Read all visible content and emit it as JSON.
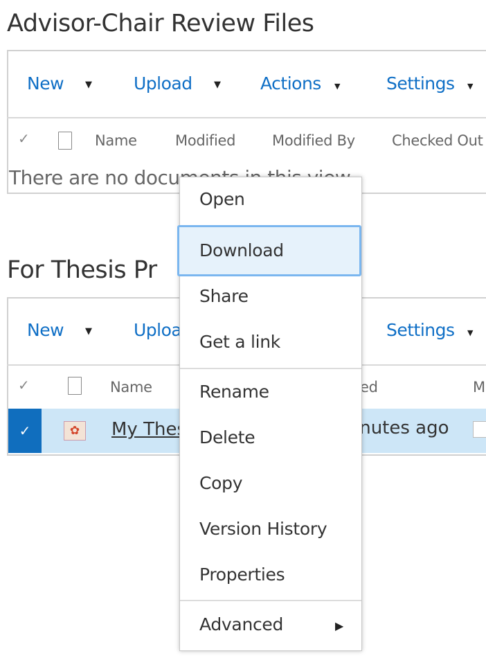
{
  "section1": {
    "title": "Advisor-Chair Review Files",
    "toolbar": [
      "New",
      "Upload",
      "Actions",
      "Settings"
    ],
    "columns": [
      "Name",
      "Modified",
      "Modified By",
      "Checked Out"
    ],
    "empty_message": "There are no documents in this view."
  },
  "section2": {
    "title": "For Thesis Pr",
    "toolbar": [
      "New",
      "Uploa",
      "Settings"
    ],
    "columns": [
      "Name",
      "ed",
      "M"
    ],
    "row": {
      "name": "My Thes",
      "modified": "inutes ago",
      "selected": true
    }
  },
  "context_menu": {
    "items": [
      "Open",
      "Download",
      "Share",
      "Get a link",
      "Rename",
      "Delete",
      "Copy",
      "Version History",
      "Properties",
      "Advanced"
    ],
    "highlighted": "Download"
  },
  "colors": {
    "accent": "#0f6fc6",
    "selected_row": "#cde6f7",
    "selected_check": "#106ebe",
    "menu_highlight": "#e6f2fb"
  }
}
